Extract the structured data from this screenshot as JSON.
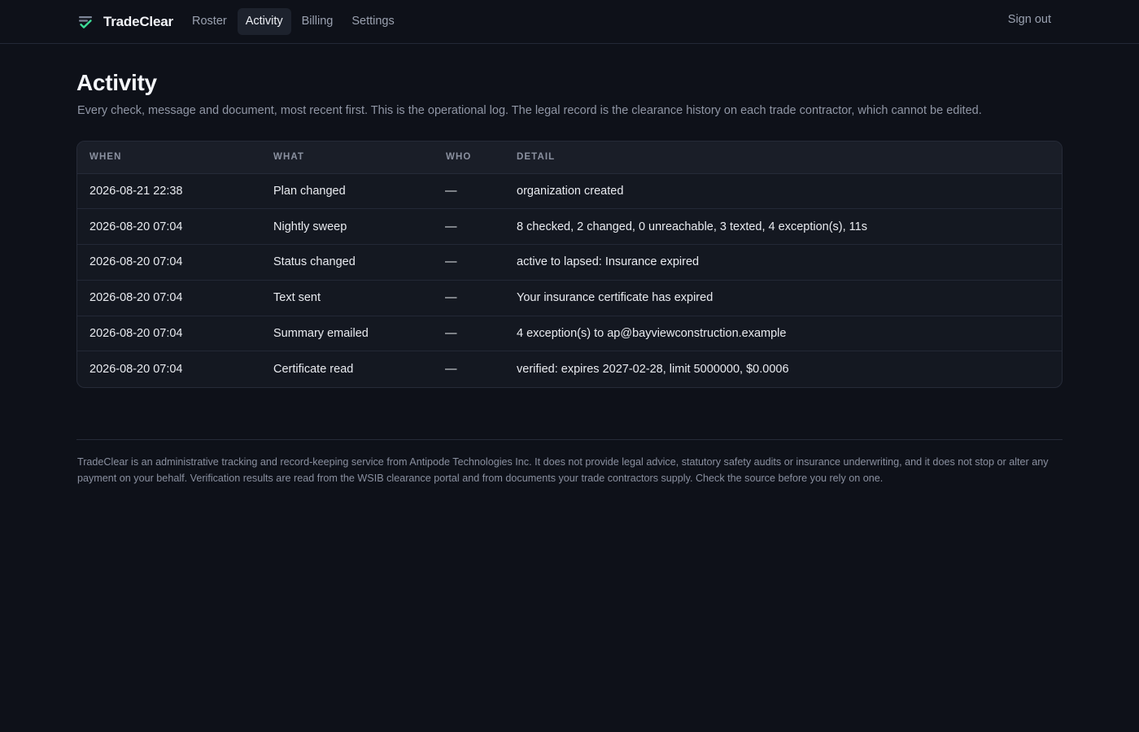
{
  "app": {
    "name": "TradeClear",
    "logo_icon": "tradeclear-check-logo-icon",
    "accent_color": "#3ddc97"
  },
  "nav": {
    "items": [
      {
        "label": "Roster",
        "active": false
      },
      {
        "label": "Activity",
        "active": true
      },
      {
        "label": "Billing",
        "active": false
      },
      {
        "label": "Settings",
        "active": false
      }
    ],
    "sign_out": "Sign out"
  },
  "page": {
    "title": "Activity",
    "subtitle": "Every check, message and document, most recent first. This is the operational log. The legal record is the clearance history on each trade contractor, which cannot be edited."
  },
  "table": {
    "columns": [
      "WHEN",
      "WHAT",
      "WHO",
      "DETAIL"
    ],
    "rows": [
      {
        "when": "2026-08-21 22:38",
        "what": "Plan changed",
        "who": "—",
        "detail": "organization created"
      },
      {
        "when": "2026-08-20 07:04",
        "what": "Nightly sweep",
        "who": "—",
        "detail": "8 checked, 2 changed, 0 unreachable, 3 texted, 4 exception(s), 11s"
      },
      {
        "when": "2026-08-20 07:04",
        "what": "Status changed",
        "who": "—",
        "detail": "active to lapsed: Insurance expired"
      },
      {
        "when": "2026-08-20 07:04",
        "what": "Text sent",
        "who": "—",
        "detail": "Your insurance certificate has expired"
      },
      {
        "when": "2026-08-20 07:04",
        "what": "Summary emailed",
        "who": "—",
        "detail": "4 exception(s) to ap@bayviewconstruction.example"
      },
      {
        "when": "2026-08-20 07:04",
        "what": "Certificate read",
        "who": "—",
        "detail": "verified: expires 2027-02-28, limit 5000000, $0.0006"
      }
    ]
  },
  "footer": {
    "text": "TradeClear is an administrative tracking and record-keeping service from Antipode Technologies Inc. It does not provide legal advice, statutory safety audits or insurance underwriting, and it does not stop or alter any payment on your behalf. Verification results are read from the WSIB clearance portal and from documents your trade contractors supply. Check the source before you rely on one."
  }
}
